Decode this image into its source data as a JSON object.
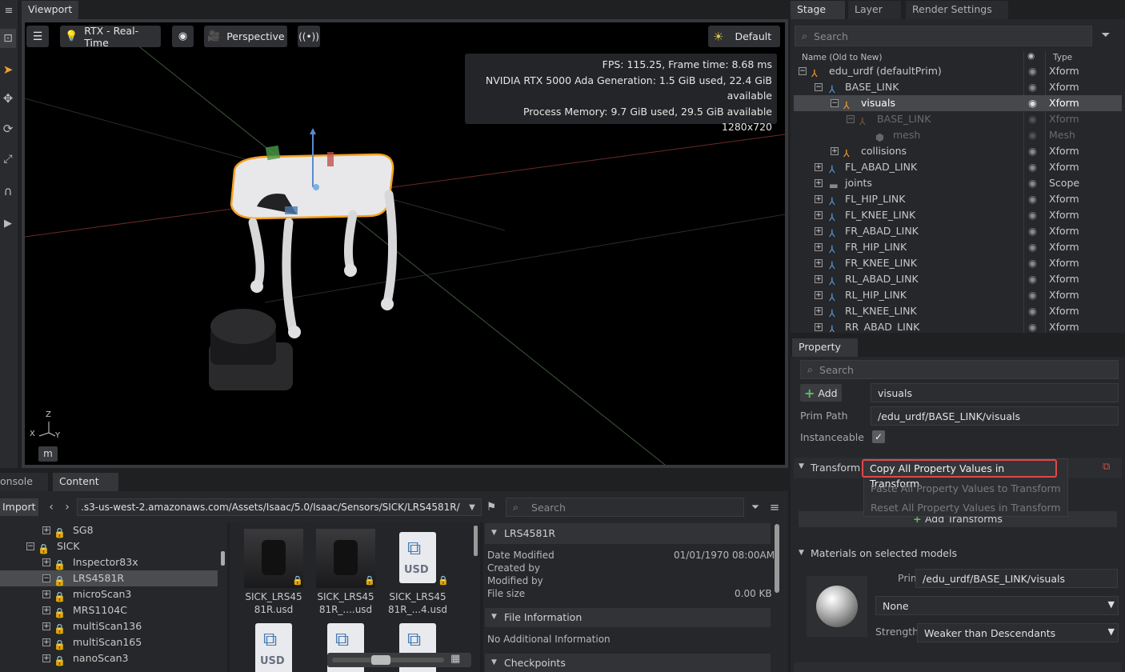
{
  "viewport": {
    "tab": "Viewport",
    "renderer": "RTX - Real-Time",
    "camera": "Perspective",
    "lighting": "Default",
    "stats": [
      "FPS: 115.25, Frame time: 8.68 ms",
      "NVIDIA RTX 5000 Ada Generation: 1.5 GiB used, 22.4 GiB available",
      "Process Memory: 9.7 GiB used, 29.5 GiB available",
      "1280x720"
    ],
    "axis": {
      "z": "Z",
      "x": "X",
      "y": "Y"
    },
    "unit": "m"
  },
  "stage": {
    "tabs": [
      "Stage",
      "Layer",
      "Render Settings"
    ],
    "search_placeholder": "Search",
    "col_name": "Name (Old to New)",
    "col_type": "Type",
    "rows": [
      {
        "name": "edu_urdf (defaultPrim)",
        "type": "Xform"
      },
      {
        "name": "BASE_LINK",
        "type": "Xform"
      },
      {
        "name": "visuals",
        "type": "Xform"
      },
      {
        "name": "BASE_LINK",
        "type": "Xform"
      },
      {
        "name": "mesh",
        "type": "Mesh"
      },
      {
        "name": "collisions",
        "type": "Xform"
      },
      {
        "name": "FL_ABAD_LINK",
        "type": "Xform"
      },
      {
        "name": "joints",
        "type": "Scope"
      },
      {
        "name": "FL_HIP_LINK",
        "type": "Xform"
      },
      {
        "name": "FL_KNEE_LINK",
        "type": "Xform"
      },
      {
        "name": "FR_ABAD_LINK",
        "type": "Xform"
      },
      {
        "name": "FR_HIP_LINK",
        "type": "Xform"
      },
      {
        "name": "FR_KNEE_LINK",
        "type": "Xform"
      },
      {
        "name": "RL_ABAD_LINK",
        "type": "Xform"
      },
      {
        "name": "RL_HIP_LINK",
        "type": "Xform"
      },
      {
        "name": "RL_KNEE_LINK",
        "type": "Xform"
      },
      {
        "name": "RR_ABAD_LINK",
        "type": "Xform"
      }
    ]
  },
  "property": {
    "tab": "Property",
    "search_placeholder": "Search",
    "add_label": "Add",
    "name_value": "visuals",
    "prim_path_label": "Prim Path",
    "prim_path_value": "/edu_urdf/BASE_LINK/visuals",
    "instanceable_label": "Instanceable",
    "transform_label": "Transform",
    "context_menu": [
      "Copy All Property Values in Transform",
      "Paste All Property Values to Transform",
      "Reset All Property Values in Transform"
    ],
    "add_transforms_label": "Add Transforms",
    "materials_label": "Materials on selected models",
    "prim_label": "Prim",
    "prim_value": "/edu_urdf/BASE_LINK/visuals",
    "material_value": "None",
    "strength_label": "Strength",
    "strength_value": "Weaker than Descendants"
  },
  "content": {
    "tabs": [
      "onsole",
      "Content"
    ],
    "import_label": "Import",
    "path": ".s3-us-west-2.amazonaws.com/Assets/Isaac/5.0/Isaac/Sensors/SICK/LRS4581R/",
    "search_placeholder": "Search",
    "tree": [
      "SG8",
      "SICK",
      "Inspector83x",
      "LRS4581R",
      "microScan3",
      "MRS1104C",
      "multiScan136",
      "multiScan165",
      "nanoScan3"
    ],
    "files": [
      [
        "SICK_LRS45",
        "81R.usd"
      ],
      [
        "SICK_LRS45",
        "81R_....usd"
      ],
      [
        "SICK_LRS45",
        "81R_...4.usd"
      ]
    ],
    "usd_badge": "USD",
    "details": {
      "title": "LRS4581R",
      "date_modified_label": "Date Modified",
      "date_modified_value": "01/01/1970 08:00AM",
      "created_by_label": "Created by",
      "modified_by_label": "Modified by",
      "file_size_label": "File size",
      "file_size_value": "0.00 KB",
      "file_info_label": "File Information",
      "no_info": "No Additional Information",
      "checkpoints_label": "Checkpoints"
    }
  }
}
